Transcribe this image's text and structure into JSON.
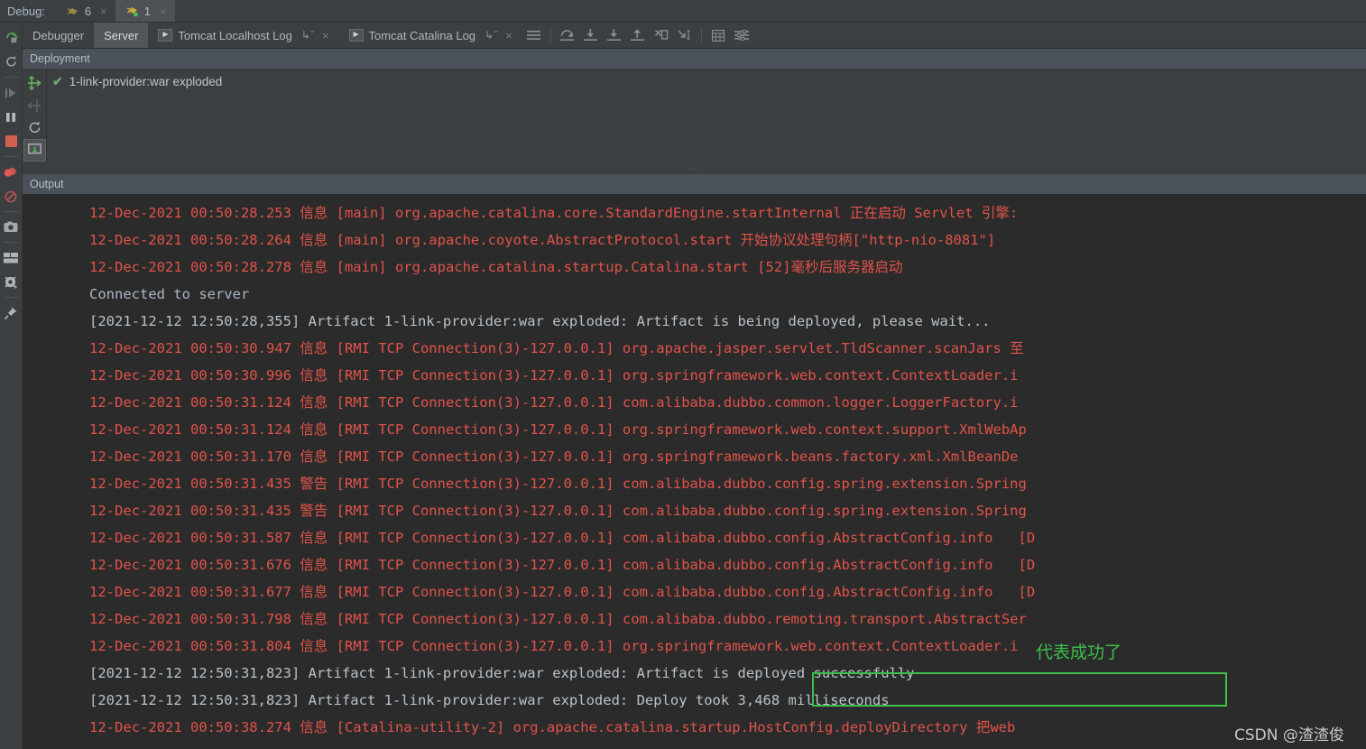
{
  "debug_bar": {
    "label": "Debug:",
    "tabs": [
      {
        "name": "debug-session-6",
        "count": "6",
        "running": false,
        "close": "×"
      },
      {
        "name": "debug-session-1",
        "count": "1",
        "running": true,
        "close": "×"
      }
    ]
  },
  "toolbar": {
    "tabs": [
      {
        "label": "Debugger",
        "active": false,
        "has_run_icon": false,
        "pin": "",
        "close": ""
      },
      {
        "label": "Server",
        "active": true,
        "has_run_icon": false,
        "pin": "",
        "close": ""
      },
      {
        "label": "Tomcat Localhost Log",
        "active": false,
        "has_run_icon": true,
        "pin": "↳˝",
        "close": "×"
      },
      {
        "label": "Tomcat Catalina Log",
        "active": false,
        "has_run_icon": true,
        "pin": "↳˝",
        "close": "×"
      }
    ],
    "buttons": [
      {
        "name": "show-execution-point-icon",
        "tip": "Show Execution Point"
      },
      {
        "name": "step-over-icon",
        "tip": "Step Over"
      },
      {
        "name": "step-into-icon",
        "tip": "Step Into"
      },
      {
        "name": "force-step-into-icon",
        "tip": "Force Step Into"
      },
      {
        "name": "step-out-icon",
        "tip": "Step Out"
      },
      {
        "name": "drop-frame-icon",
        "tip": "Drop Frame"
      },
      {
        "name": "run-to-cursor-icon",
        "tip": "Run to Cursor"
      },
      {
        "name": "evaluate-expression-icon",
        "tip": "Evaluate Expression"
      },
      {
        "name": "settings-layout-icon",
        "tip": "Layout Settings"
      }
    ]
  },
  "left_gutter": {
    "items": [
      {
        "name": "rerun-icon"
      },
      {
        "name": "update-running-application-icon"
      },
      {
        "name": "resume-program-icon"
      },
      {
        "name": "pause-program-icon"
      },
      {
        "name": "stop-icon"
      },
      {
        "name": "view-breakpoints-icon"
      },
      {
        "name": "mute-breakpoints-icon"
      },
      {
        "name": "screenshot-icon"
      },
      {
        "name": "restore-layout-icon"
      },
      {
        "name": "settings-gear-icon"
      },
      {
        "name": "pin-tab-icon"
      }
    ]
  },
  "deployment": {
    "title": "Deployment",
    "tools": [
      {
        "name": "deploy-artifact-icon",
        "selected": false
      },
      {
        "name": "undeploy-artifact-icon",
        "selected": false
      },
      {
        "name": "redeploy-icon",
        "selected": false
      },
      {
        "name": "show-deployment-output-icon",
        "selected": true
      }
    ],
    "artifact": {
      "status_icon": "✔",
      "label": "1-link-provider:war exploded"
    }
  },
  "output": {
    "title": "Output",
    "lines": [
      {
        "kind": "err",
        "text": "12-Dec-2021 00:50:28.253 信息 [main] org.apache.catalina.core.StandardEngine.startInternal 正在启动 Servlet 引擎:"
      },
      {
        "kind": "err",
        "text": "12-Dec-2021 00:50:28.264 信息 [main] org.apache.coyote.AbstractProtocol.start 开始协议处理句柄[\"http-nio-8081\"]"
      },
      {
        "kind": "err",
        "text": "12-Dec-2021 00:50:28.278 信息 [main] org.apache.catalina.startup.Catalina.start [52]毫秒后服务器启动"
      },
      {
        "kind": "sys",
        "text": "Connected to server"
      },
      {
        "kind": "out",
        "text": "[2021-12-12 12:50:28,355] Artifact 1-link-provider:war exploded: Artifact is being deployed, please wait..."
      },
      {
        "kind": "err",
        "text": "12-Dec-2021 00:50:30.947 信息 [RMI TCP Connection(3)-127.0.0.1] org.apache.jasper.servlet.TldScanner.scanJars 至"
      },
      {
        "kind": "err",
        "text": "12-Dec-2021 00:50:30.996 信息 [RMI TCP Connection(3)-127.0.0.1] org.springframework.web.context.ContextLoader.i"
      },
      {
        "kind": "err",
        "text": "12-Dec-2021 00:50:31.124 信息 [RMI TCP Connection(3)-127.0.0.1] com.alibaba.dubbo.common.logger.LoggerFactory.i"
      },
      {
        "kind": "err",
        "text": "12-Dec-2021 00:50:31.124 信息 [RMI TCP Connection(3)-127.0.0.1] org.springframework.web.context.support.XmlWebAp"
      },
      {
        "kind": "err",
        "text": "12-Dec-2021 00:50:31.170 信息 [RMI TCP Connection(3)-127.0.0.1] org.springframework.beans.factory.xml.XmlBeanDe"
      },
      {
        "kind": "err",
        "text": "12-Dec-2021 00:50:31.435 警告 [RMI TCP Connection(3)-127.0.0.1] com.alibaba.dubbo.config.spring.extension.Spring"
      },
      {
        "kind": "err",
        "text": "12-Dec-2021 00:50:31.435 警告 [RMI TCP Connection(3)-127.0.0.1] com.alibaba.dubbo.config.spring.extension.Spring"
      },
      {
        "kind": "err",
        "text": "12-Dec-2021 00:50:31.587 信息 [RMI TCP Connection(3)-127.0.0.1] com.alibaba.dubbo.config.AbstractConfig.info   [D"
      },
      {
        "kind": "err",
        "text": "12-Dec-2021 00:50:31.676 信息 [RMI TCP Connection(3)-127.0.0.1] com.alibaba.dubbo.config.AbstractConfig.info   [D"
      },
      {
        "kind": "err",
        "text": "12-Dec-2021 00:50:31.677 信息 [RMI TCP Connection(3)-127.0.0.1] com.alibaba.dubbo.config.AbstractConfig.info   [D"
      },
      {
        "kind": "err",
        "text": "12-Dec-2021 00:50:31.798 信息 [RMI TCP Connection(3)-127.0.0.1] com.alibaba.dubbo.remoting.transport.AbstractSer"
      },
      {
        "kind": "err",
        "text": "12-Dec-2021 00:50:31.804 信息 [RMI TCP Connection(3)-127.0.0.1] org.springframework.web.context.ContextLoader.i"
      },
      {
        "kind": "out",
        "text": "[2021-12-12 12:50:31,823] Artifact 1-link-provider:war exploded: Artifact is deployed successfully"
      },
      {
        "kind": "out",
        "text": "[2021-12-12 12:50:31,823] Artifact 1-link-provider:war exploded: Deploy took 3,468 milliseconds"
      },
      {
        "kind": "err",
        "text": "12-Dec-2021 00:50:38.274 信息 [Catalina-utility-2] org.apache.catalina.startup.HostConfig.deployDirectory 把web"
      }
    ]
  },
  "annotations": {
    "highlight_note": "代表成功了",
    "highlight_color": "#3cbf4a"
  },
  "watermark": {
    "text": "CSDN @渣渣俊"
  }
}
